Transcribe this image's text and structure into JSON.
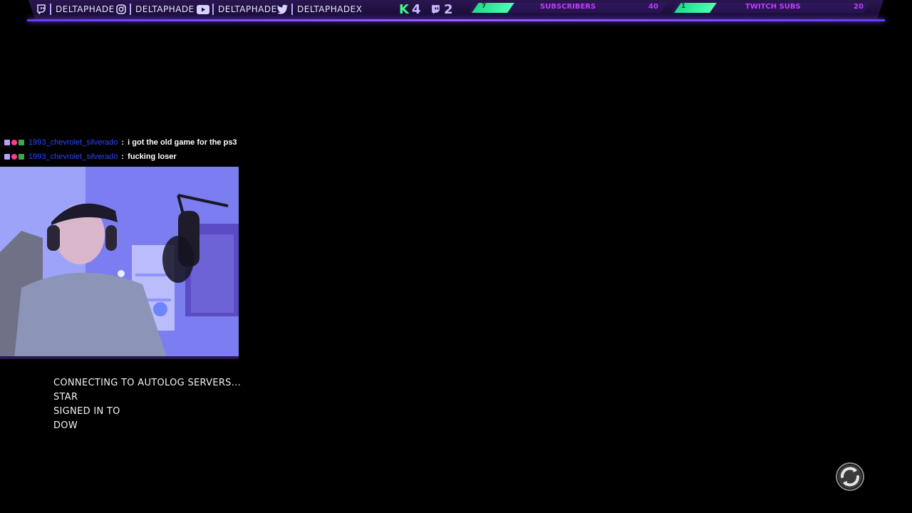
{
  "socials": [
    {
      "icon": "twitch-icon",
      "label": "DELTAPHADE"
    },
    {
      "icon": "instagram-icon",
      "label": "DELTAPHADE"
    },
    {
      "icon": "youtube-icon",
      "label": "DELTAPHADE"
    },
    {
      "icon": "twitter-icon",
      "label": "DELTAPHADEX"
    }
  ],
  "counters": {
    "kick_count": "4",
    "twitch_count": "2"
  },
  "goals": [
    {
      "label": "SUBSCRIBERS",
      "current": "7",
      "target": "40",
      "progress": 0.175
    },
    {
      "label": "TWITCH SUBS",
      "current": "1",
      "target": "20",
      "progress": 0.05
    }
  ],
  "chat": [
    {
      "user": "1993_chevrolet_silverado",
      "message": "i got the old game for the ps3"
    },
    {
      "user": "1993_chevrolet_silverado",
      "message": "fucking loser"
    }
  ],
  "game_status": {
    "lines": [
      "CONNECTING TO AUTOLOG SERVERS...",
      "STAR",
      "SIGNED IN TO",
      "DOW"
    ]
  },
  "colors": {
    "accent_purple": "#7b4cff",
    "goal_green": "#3bff8a",
    "goal_text": "#c23bff",
    "chat_user": "#2b47ff"
  }
}
